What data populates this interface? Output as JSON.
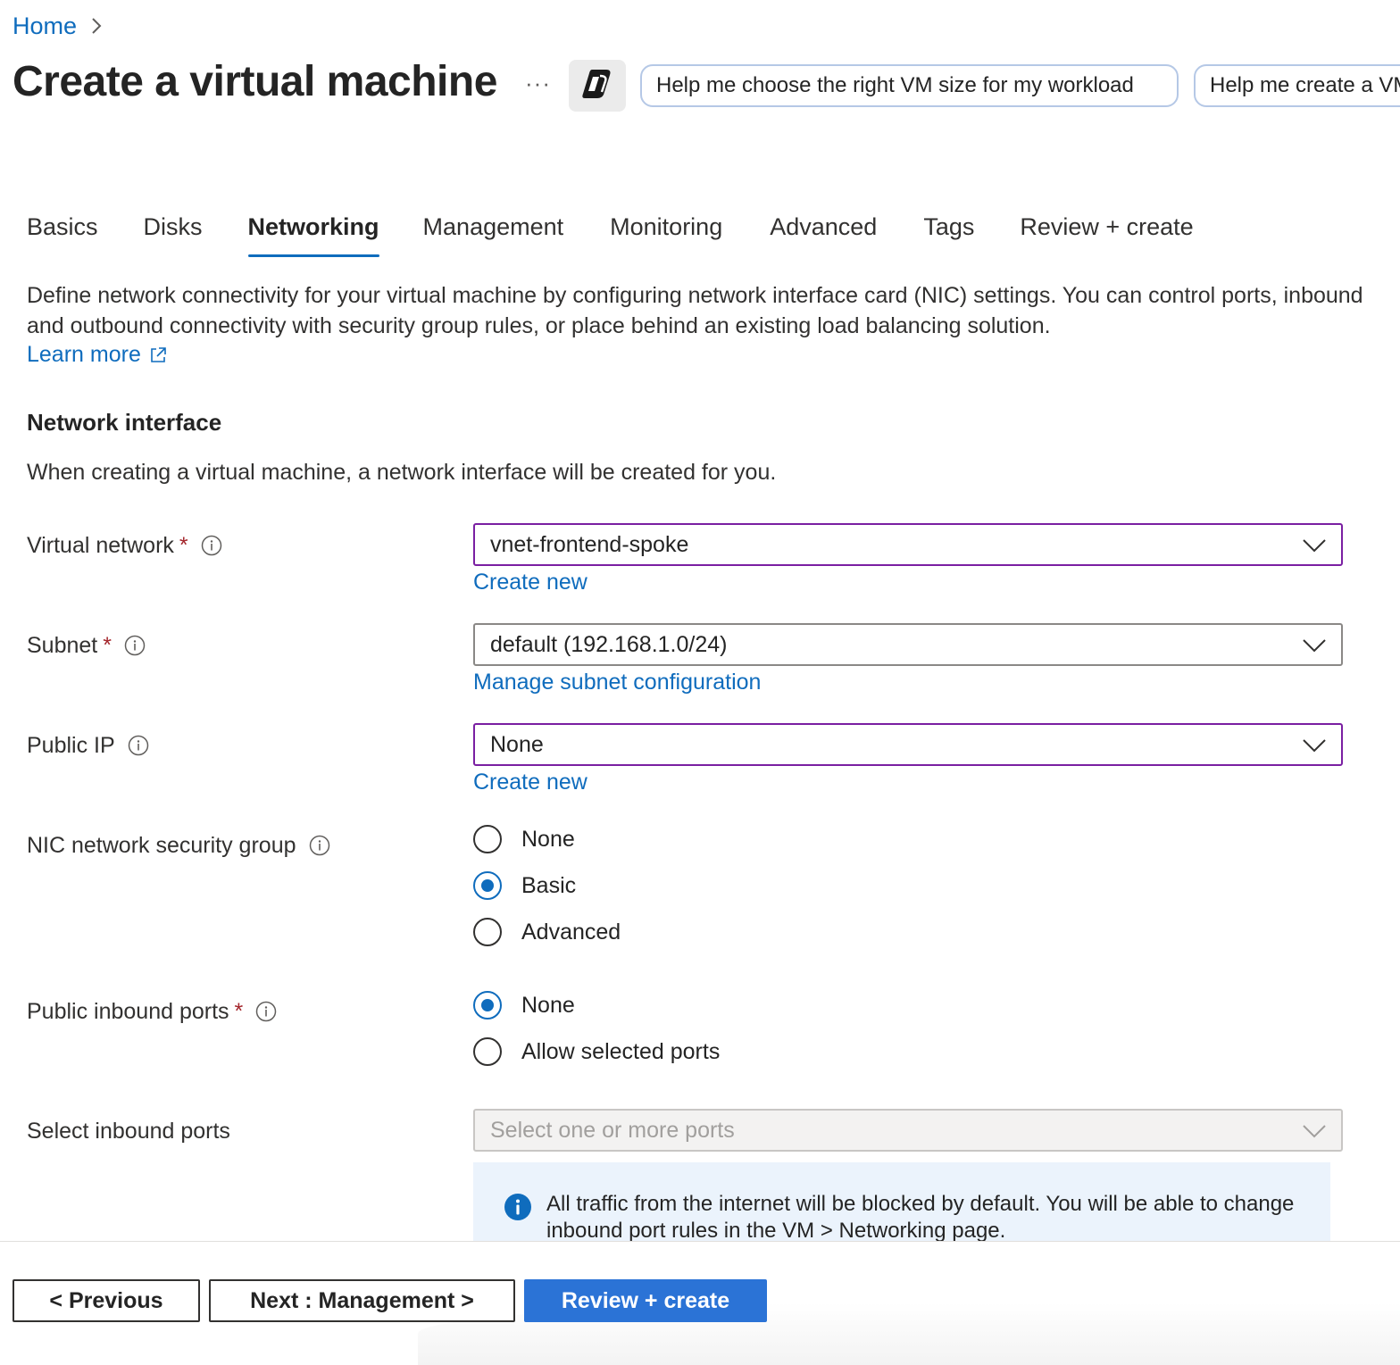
{
  "breadcrumb": {
    "home": "Home"
  },
  "page": {
    "title": "Create a virtual machine",
    "more": "···"
  },
  "copilot": {
    "icon": "copilot-icon",
    "prompts": [
      "Help me choose the right VM size for my workload",
      "Help me create a VM"
    ]
  },
  "tabs": [
    {
      "label": "Basics",
      "active": false
    },
    {
      "label": "Disks",
      "active": false
    },
    {
      "label": "Networking",
      "active": true
    },
    {
      "label": "Management",
      "active": false
    },
    {
      "label": "Monitoring",
      "active": false
    },
    {
      "label": "Advanced",
      "active": false
    },
    {
      "label": "Tags",
      "active": false
    },
    {
      "label": "Review + create",
      "active": false
    }
  ],
  "intro": {
    "text": "Define network connectivity for your virtual machine by configuring network interface card (NIC) settings. You can control ports, inbound and outbound connectivity with security group rules, or place behind an existing load balancing solution.",
    "learn_more": "Learn more"
  },
  "network_interface": {
    "heading": "Network interface",
    "description": "When creating a virtual machine, a network interface will be created for you."
  },
  "fields": {
    "virtual_network": {
      "label": "Virtual network",
      "required": "*",
      "value": "vnet-frontend-spoke",
      "link": "Create new"
    },
    "subnet": {
      "label": "Subnet",
      "required": "*",
      "value": "default (192.168.1.0/24)",
      "link": "Manage subnet configuration"
    },
    "public_ip": {
      "label": "Public IP",
      "value": "None",
      "link": "Create new"
    },
    "nic_nsg": {
      "label": "NIC network security group",
      "options": [
        "None",
        "Basic",
        "Advanced"
      ],
      "selected": "Basic"
    },
    "public_inbound_ports": {
      "label": "Public inbound ports",
      "required": "*",
      "options": [
        "None",
        "Allow selected ports"
      ],
      "selected": "None"
    },
    "select_inbound_ports": {
      "label": "Select inbound ports",
      "placeholder": "Select one or more ports"
    }
  },
  "info_banner": {
    "text": "All traffic from the internet will be blocked by default. You will be able to change inbound port rules in the VM > Networking page."
  },
  "footer": {
    "previous": "< Previous",
    "next": "Next : Management >",
    "review": "Review + create"
  },
  "colors": {
    "accent": "#0f6cbd",
    "primary_button": "#2b73d6",
    "focus_border": "#7a1fa2",
    "required": "#a4262c"
  }
}
